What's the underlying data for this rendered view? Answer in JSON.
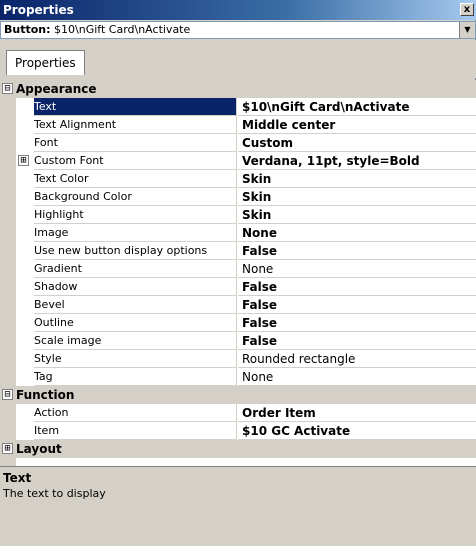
{
  "window": {
    "title": "Properties",
    "close_glyph": "x"
  },
  "selector": {
    "kind_label": "Button:",
    "object_name": "$10\\nGift Card\\nActivate"
  },
  "tabs": [
    {
      "label": "Properties"
    }
  ],
  "categories": [
    {
      "label": "Appearance",
      "state": "expanded",
      "glyph": "⊟"
    },
    {
      "label": "Function",
      "state": "expanded",
      "glyph": "⊟"
    },
    {
      "label": "Layout",
      "state": "collapsed",
      "glyph": "⊞"
    }
  ],
  "appearance": [
    {
      "name": "Text",
      "value": "$10\\nGift Card\\nActivate",
      "bold": true,
      "selected": true
    },
    {
      "name": "Text Alignment",
      "value": "Middle center",
      "bold": true
    },
    {
      "name": "Font",
      "value": "Custom",
      "bold": true
    },
    {
      "name": "Custom Font",
      "value": "Verdana, 11pt, style=Bold",
      "bold": true,
      "expandable": true,
      "glyph": "⊞"
    },
    {
      "name": "Text Color",
      "value": "Skin",
      "bold": true
    },
    {
      "name": "Background Color",
      "value": "Skin",
      "bold": true
    },
    {
      "name": "Highlight",
      "value": "Skin",
      "bold": true
    },
    {
      "name": "Image",
      "value": "None",
      "bold": true
    },
    {
      "name": "Use new button display options",
      "value": "False",
      "bold": true
    },
    {
      "name": "Gradient",
      "value": "None",
      "bold": false
    },
    {
      "name": "Shadow",
      "value": "False",
      "bold": true
    },
    {
      "name": "Bevel",
      "value": "False",
      "bold": true
    },
    {
      "name": "Outline",
      "value": "False",
      "bold": true
    },
    {
      "name": "Scale image",
      "value": "False",
      "bold": true
    },
    {
      "name": "Style",
      "value": "Rounded rectangle",
      "bold": false
    },
    {
      "name": "Tag",
      "value": "None",
      "bold": false
    }
  ],
  "function": [
    {
      "name": "Action",
      "value": "Order Item",
      "bold": true
    },
    {
      "name": "Item",
      "value": "$10 GC Activate",
      "bold": true
    }
  ],
  "description": {
    "title": "Text",
    "text": "The text to display"
  },
  "colors": {
    "selection": "#0a246a",
    "panel": "#d4d0c8"
  }
}
